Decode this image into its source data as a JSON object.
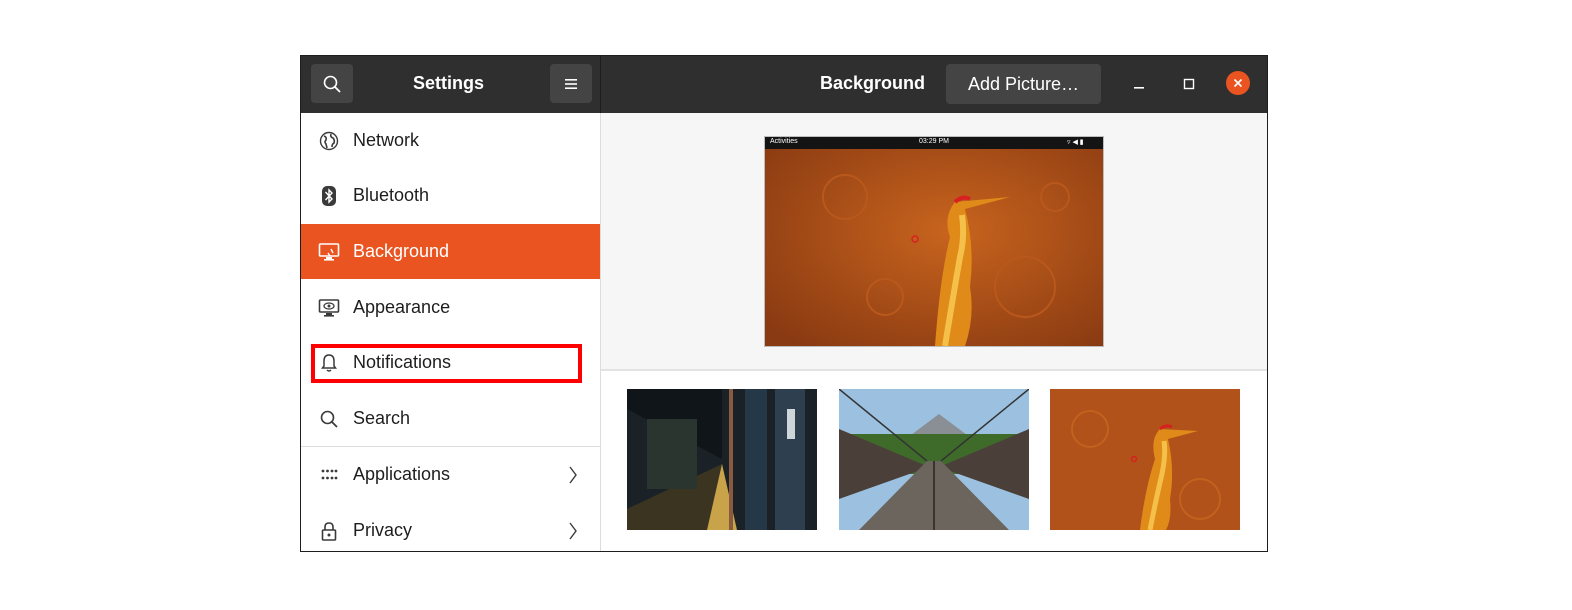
{
  "app": {
    "settings_title": "Settings",
    "panel_title": "Background",
    "add_button_label": "Add Picture…"
  },
  "sidebar": {
    "items": [
      {
        "label": "Network",
        "icon": "globe-icon"
      },
      {
        "label": "Bluetooth",
        "icon": "bluetooth-icon"
      },
      {
        "label": "Background",
        "icon": "monitor-icon",
        "active": true
      },
      {
        "label": "Appearance",
        "icon": "appearance-icon"
      },
      {
        "label": "Notifications",
        "icon": "bell-icon",
        "highlighted": true
      },
      {
        "label": "Search",
        "icon": "search-icon"
      },
      {
        "label": "Applications",
        "icon": "apps-grid-icon",
        "has_submenu": true
      },
      {
        "label": "Privacy",
        "icon": "lock-icon",
        "has_submenu": true
      }
    ]
  },
  "preview": {
    "topbar_left": "Activities",
    "topbar_center": "03:29 PM"
  },
  "wallpapers": [
    {
      "name": "subway-tunnel"
    },
    {
      "name": "suspension-bridge"
    },
    {
      "name": "orange-heron"
    }
  ],
  "colors": {
    "accent": "#e95420",
    "headerbar": "#2f2f2f",
    "highlight": "#ff0000"
  }
}
